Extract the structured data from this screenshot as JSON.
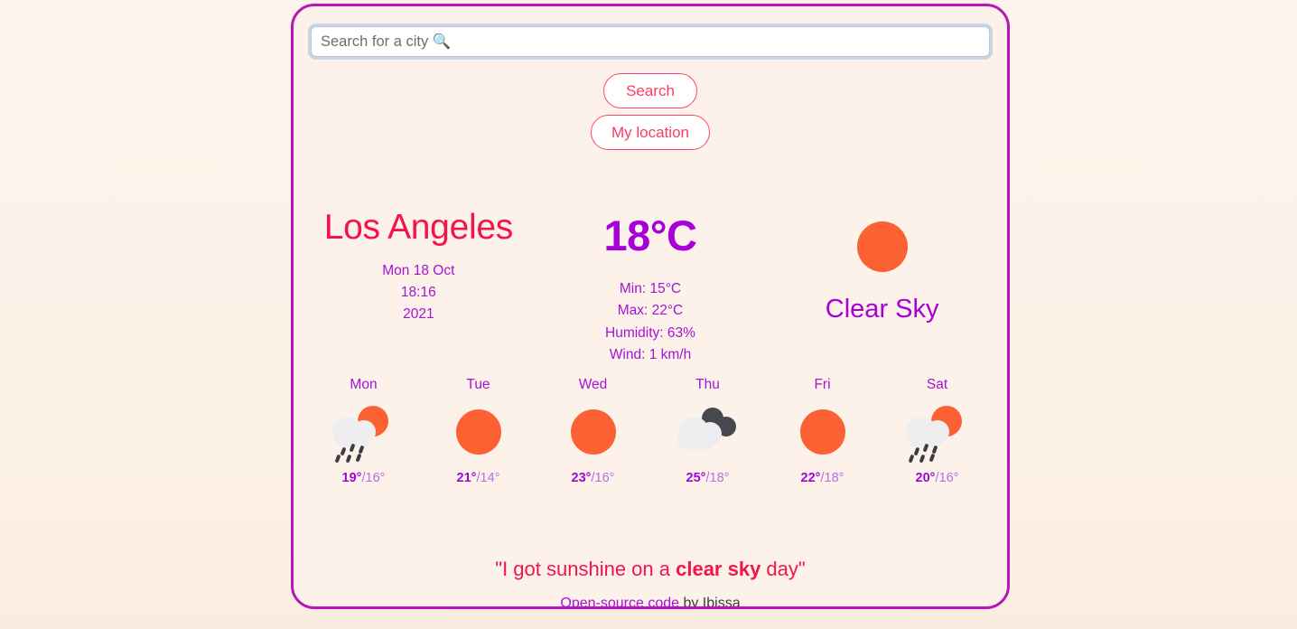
{
  "colors": {
    "page_background": "#fdf3ea",
    "card_background": "#fdf2e9",
    "card_border": "#b915bb",
    "accent_pink": "#f2134f",
    "accent_purple": "#a313d8",
    "button_pink": "#fb4570",
    "sun_orange": "#fb6133",
    "cloud_light": "#eeeef0",
    "cloud_dark": "#474750"
  },
  "search": {
    "placeholder": "Search for a city 🔍",
    "value": "",
    "icon": "search-icon"
  },
  "buttons": {
    "search_label": "Search",
    "my_location_label": "My location"
  },
  "current": {
    "city": "Los Angeles",
    "date": "Mon 18 Oct",
    "time": "18:16",
    "year": "2021",
    "temperature": "18°C",
    "min": "Min: 15°C",
    "max": "Max: 22°C",
    "humidity": "Humidity: 63%",
    "wind": "Wind: 1 km/h",
    "condition": "Clear Sky",
    "condition_icon": "sun-icon"
  },
  "forecast": [
    {
      "day": "Mon",
      "icon": "sun-rain-icon",
      "max": "19°",
      "min": "/16°"
    },
    {
      "day": "Tue",
      "icon": "sun-icon",
      "max": "21°",
      "min": "/14°"
    },
    {
      "day": "Wed",
      "icon": "sun-icon",
      "max": "23°",
      "min": "/16°"
    },
    {
      "day": "Thu",
      "icon": "broken-clouds-icon",
      "max": "25°",
      "min": "/18°"
    },
    {
      "day": "Fri",
      "icon": "sun-icon",
      "max": "22°",
      "min": "/18°"
    },
    {
      "day": "Sat",
      "icon": "sun-rain-icon",
      "max": "20°",
      "min": "/16°"
    }
  ],
  "footer": {
    "quote_prefix": "\"I got sunshine on a ",
    "quote_bold": "clear sky",
    "quote_suffix": " day\"",
    "link_label": "Open-source code",
    "credit_suffix": " by Ibissa"
  }
}
